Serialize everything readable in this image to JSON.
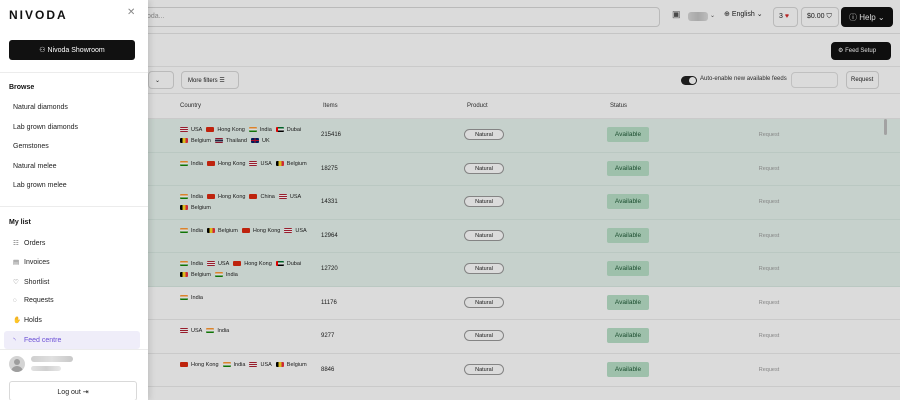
{
  "topbar": {
    "search_placeholder": "oda...",
    "language": "English",
    "cart_count": "3",
    "cart_total": "$0.00",
    "help_label": "Help"
  },
  "toolbar": {
    "feed_setup_label": "Feed Setup",
    "more_filters_label": "More filters",
    "auto_enable_label": "Auto-enable new available feeds",
    "request_label": "Request"
  },
  "table": {
    "columns": [
      "Country",
      "Items",
      "Product",
      "Status"
    ],
    "rows": [
      {
        "countries": [
          {
            "name": "USA",
            "flag": "us"
          },
          {
            "name": "Hong Kong",
            "flag": "hk"
          },
          {
            "name": "India",
            "flag": "in"
          },
          {
            "name": "Dubai",
            "flag": "ae"
          },
          {
            "name": "Belgium",
            "flag": "be"
          },
          {
            "name": "Thailand",
            "flag": "th"
          },
          {
            "name": "UK",
            "flag": "uk"
          }
        ],
        "items": "215416",
        "product": "Natural",
        "status": "Available",
        "action": "Request",
        "highlight": true
      },
      {
        "countries": [
          {
            "name": "India",
            "flag": "in"
          },
          {
            "name": "Hong Kong",
            "flag": "hk"
          },
          {
            "name": "USA",
            "flag": "us"
          },
          {
            "name": "Belgium",
            "flag": "be"
          }
        ],
        "items": "18275",
        "product": "Natural",
        "status": "Available",
        "action": "Request",
        "highlight": true
      },
      {
        "countries": [
          {
            "name": "India",
            "flag": "in"
          },
          {
            "name": "Hong Kong",
            "flag": "hk"
          },
          {
            "name": "China",
            "flag": "cn"
          },
          {
            "name": "USA",
            "flag": "us"
          },
          {
            "name": "Belgium",
            "flag": "be"
          }
        ],
        "items": "14331",
        "product": "Natural",
        "status": "Available",
        "action": "Request",
        "highlight": true
      },
      {
        "countries": [
          {
            "name": "India",
            "flag": "in"
          },
          {
            "name": "Belgium",
            "flag": "be"
          },
          {
            "name": "Hong Kong",
            "flag": "hk"
          },
          {
            "name": "USA",
            "flag": "us"
          }
        ],
        "items": "12964",
        "product": "Natural",
        "status": "Available",
        "action": "Request",
        "highlight": true
      },
      {
        "countries": [
          {
            "name": "India",
            "flag": "in"
          },
          {
            "name": "USA",
            "flag": "us"
          },
          {
            "name": "Hong Kong",
            "flag": "hk"
          },
          {
            "name": "Dubai",
            "flag": "ae"
          },
          {
            "name": "Belgium",
            "flag": "be"
          },
          {
            "name": "India",
            "flag": "in"
          }
        ],
        "items": "12720",
        "product": "Natural",
        "status": "Available",
        "action": "Request",
        "highlight": true
      },
      {
        "countries": [
          {
            "name": "India",
            "flag": "in"
          }
        ],
        "items": "11176",
        "product": "Natural",
        "status": "Available",
        "action": "Request",
        "highlight": false
      },
      {
        "countries": [
          {
            "name": "USA",
            "flag": "us"
          },
          {
            "name": "India",
            "flag": "in"
          }
        ],
        "items": "9277",
        "product": "Natural",
        "status": "Available",
        "action": "Request",
        "highlight": false
      },
      {
        "countries": [
          {
            "name": "Hong Kong",
            "flag": "hk"
          },
          {
            "name": "India",
            "flag": "in"
          },
          {
            "name": "USA",
            "flag": "us"
          },
          {
            "name": "Belgium",
            "flag": "be"
          }
        ],
        "items": "8846",
        "product": "Natural",
        "status": "Available",
        "action": "Request",
        "highlight": false
      }
    ]
  },
  "drawer": {
    "logo": "NIVODA",
    "showroom_label": "Nivoda Showroom",
    "browse_title": "Browse",
    "browse_items": [
      "Natural diamonds",
      "Lab grown diamonds",
      "Gemstones",
      "Natural melee",
      "Lab grown melee"
    ],
    "mylist_title": "My list",
    "mylist_items": [
      {
        "label": "Orders",
        "icon": "orders-icon",
        "glyph": "☷"
      },
      {
        "label": "Invoices",
        "icon": "invoice-icon",
        "glyph": "▤"
      },
      {
        "label": "Shortlist",
        "icon": "heart-icon",
        "glyph": "♡"
      },
      {
        "label": "Requests",
        "icon": "request-icon",
        "glyph": "◌"
      },
      {
        "label": "Holds",
        "icon": "hand-icon",
        "glyph": "✋"
      },
      {
        "label": "Feed centre",
        "icon": "rss-icon",
        "glyph": "◝"
      }
    ],
    "active_item": "Feed centre",
    "logout_label": "Log out"
  },
  "colors": {
    "accent": "#6b4fd6",
    "available_bg": "#b8e0c8",
    "highlight_row": "#e7f4ee",
    "dark": "#111111"
  }
}
